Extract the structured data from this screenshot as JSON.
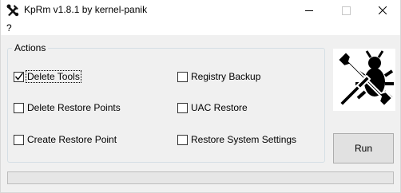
{
  "window": {
    "title": "KpRm v1.8.1 by kernel-panik"
  },
  "menu": {
    "items": [
      "?"
    ]
  },
  "actions": {
    "group_label": "Actions",
    "options": [
      {
        "label": "Delete Tools",
        "checked": true,
        "focused": true
      },
      {
        "label": "Delete Restore Points",
        "checked": false
      },
      {
        "label": "Create Restore Point",
        "checked": false
      },
      {
        "label": "Registry Backup",
        "checked": false
      },
      {
        "label": "UAC Restore",
        "checked": false
      },
      {
        "label": "Restore System Settings",
        "checked": false
      }
    ]
  },
  "run_button": {
    "label": "Run"
  },
  "progress": {
    "value": 0
  },
  "icons": {
    "app": "tools-icon",
    "logo": "bug-and-wrench-icon"
  },
  "colors": {
    "progress_fill": "#06b025",
    "button_bg": "#e1e1e1"
  }
}
